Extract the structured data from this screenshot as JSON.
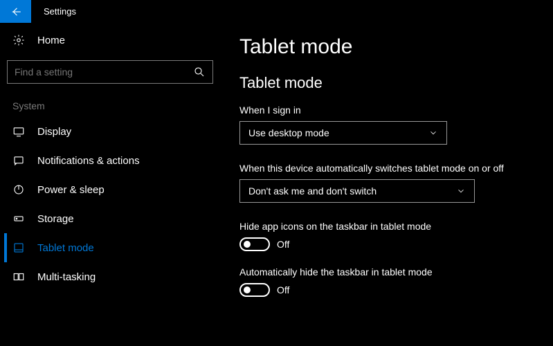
{
  "header": {
    "app_title": "Settings"
  },
  "sidebar": {
    "home_label": "Home",
    "search_placeholder": "Find a setting",
    "group_label": "System",
    "items": [
      {
        "label": "Display"
      },
      {
        "label": "Notifications & actions"
      },
      {
        "label": "Power & sleep"
      },
      {
        "label": "Storage"
      },
      {
        "label": "Tablet mode"
      },
      {
        "label": "Multi-tasking"
      }
    ]
  },
  "main": {
    "page_title": "Tablet mode",
    "section_title": "Tablet mode",
    "sign_in": {
      "label": "When I sign in",
      "value": "Use desktop mode"
    },
    "auto_switch": {
      "label": "When this device automatically switches tablet mode on or off",
      "value": "Don't ask me and don't switch"
    },
    "hide_icons": {
      "label": "Hide app icons on the taskbar in tablet mode",
      "value": "Off"
    },
    "hide_taskbar": {
      "label": "Automatically hide the taskbar in tablet mode",
      "value": "Off"
    }
  }
}
